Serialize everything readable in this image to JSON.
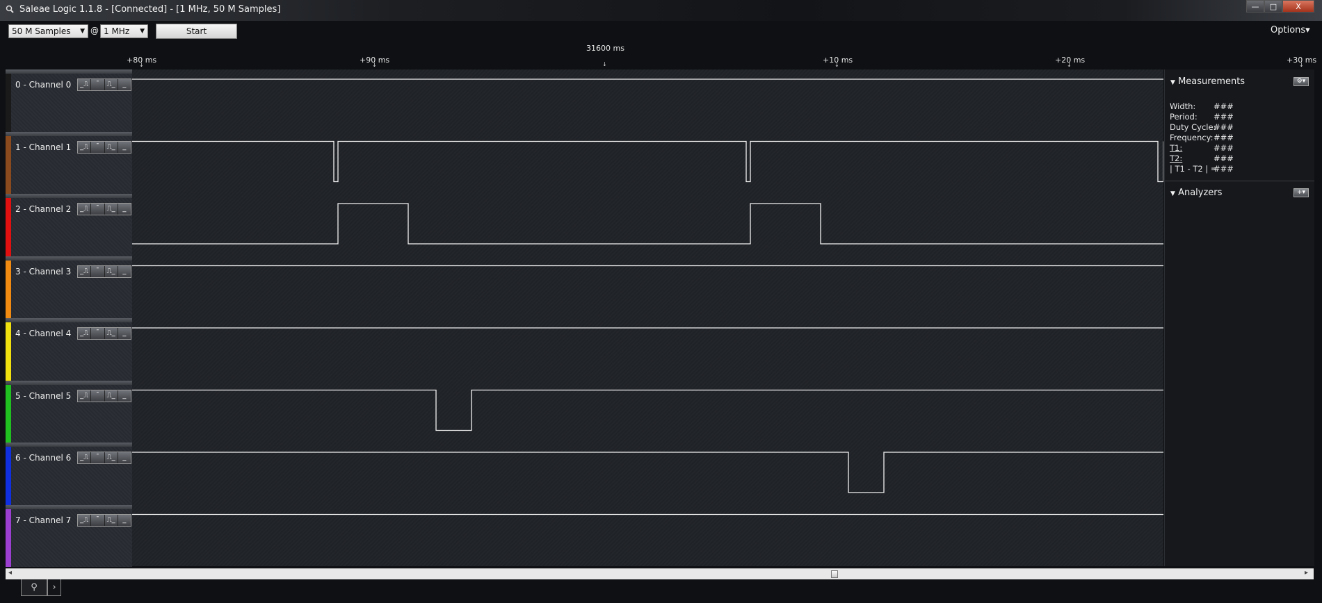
{
  "window": {
    "title": "Saleae Logic 1.1.8 - [Connected] - [1 MHz, 50 M Samples]",
    "minimize_label": "—",
    "maximize_label": "□",
    "close_label": "X"
  },
  "toolbar": {
    "samples_value": "50 M Samples",
    "at_label": "@",
    "rate_value": "1 MHz",
    "start_label": "Start",
    "options_label": "Options▾"
  },
  "ruler": {
    "center_time": "31600 ms",
    "ticks": [
      "+80 ms",
      "+90 ms",
      "+10 ms",
      "+20 ms",
      "+30 ms"
    ]
  },
  "channels": [
    {
      "label": "0 - Channel 0",
      "color": "#1a1a1a",
      "idle": "high"
    },
    {
      "label": "1 - Channel 1",
      "color": "#8b4a1e",
      "idle": "high"
    },
    {
      "label": "2 - Channel 2",
      "color": "#e01010",
      "idle": "low"
    },
    {
      "label": "3 - Channel 3",
      "color": "#f08a10",
      "idle": "high"
    },
    {
      "label": "4 - Channel 4",
      "color": "#f0e010",
      "idle": "high"
    },
    {
      "label": "5 - Channel 5",
      "color": "#20c020",
      "idle": "high"
    },
    {
      "label": "6 - Channel 6",
      "color": "#1030e0",
      "idle": "high"
    },
    {
      "label": "7 - Channel 7",
      "color": "#9b3fd0",
      "idle": "high"
    }
  ],
  "trigger_buttons": [
    "_⎍",
    "¯",
    "⎍_",
    "_"
  ],
  "measurements": {
    "header": "Measurements",
    "rows": [
      {
        "label": "Width:",
        "value": "###"
      },
      {
        "label": "Period:",
        "value": "###"
      },
      {
        "label": "Duty Cycle:",
        "value": "###"
      },
      {
        "label": "Frequency:",
        "value": "###"
      },
      {
        "label": "T1:",
        "value": "###"
      },
      {
        "label": "T2:",
        "value": "###"
      },
      {
        "label": "| T1 - T2 | =",
        "value": "###"
      }
    ]
  },
  "analyzers": {
    "header": "Analyzers",
    "add_label": "+▾"
  },
  "bottom": {
    "left_arrow": "◂",
    "right_arrow": "▸",
    "tab_search": "⚲",
    "tab_scripts": "›"
  }
}
